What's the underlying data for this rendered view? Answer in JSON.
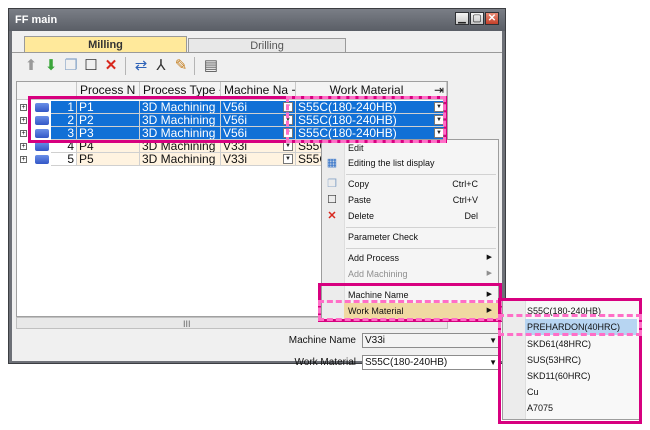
{
  "window": {
    "title": "FF main",
    "buttons": {
      "minimize": "▁",
      "maximize": "▢",
      "close": "✕"
    }
  },
  "tabs": [
    {
      "label": "Milling",
      "active": true
    },
    {
      "label": "Drilling",
      "active": false
    }
  ],
  "toolbar": {
    "icons": [
      "arrow-up-icon",
      "arrow-down-icon",
      "copy-icon",
      "paste-icon",
      "delete-icon",
      "link-icon",
      "axis-icon",
      "edit-list-icon",
      "database-icon"
    ]
  },
  "grid": {
    "columns": [
      "Process N",
      "Process Type",
      "Machine Na",
      "Work Material"
    ],
    "rows": [
      {
        "no": "1",
        "name": "P1",
        "type": "3D Machining",
        "machine": "V56i",
        "material": "S55C(180-240HB)",
        "selected": true
      },
      {
        "no": "2",
        "name": "P2",
        "type": "3D Machining",
        "machine": "V56i",
        "material": "S55C(180-240HB)",
        "selected": true
      },
      {
        "no": "3",
        "name": "P3",
        "type": "3D Machining",
        "machine": "V56i",
        "material": "S55C(180-240HB)",
        "selected": true
      },
      {
        "no": "4",
        "name": "P4",
        "type": "3D Machining",
        "machine": "V33i",
        "material": "S55C",
        "selected": false
      },
      {
        "no": "5",
        "name": "P5",
        "type": "3D Machining",
        "machine": "V33i",
        "material": "S55C",
        "selected": false
      }
    ],
    "scroll_glyph": "III"
  },
  "fields": {
    "machine_name": {
      "label": "Machine Name",
      "value": "V33i"
    },
    "work_material": {
      "label": "Work Material",
      "value": "S55C(180-240HB)"
    }
  },
  "context_menu": {
    "items": [
      {
        "label": "Edit",
        "shortcut": ""
      },
      {
        "label": "Editing the list display",
        "shortcut": ""
      },
      {
        "label": "Copy",
        "shortcut": "Ctrl+C"
      },
      {
        "label": "Paste",
        "shortcut": "Ctrl+V"
      },
      {
        "label": "Delete",
        "shortcut": "Del"
      },
      {
        "label": "Parameter Check",
        "shortcut": ""
      },
      {
        "label": "Add Process",
        "shortcut": ""
      },
      {
        "label": "Add Machining",
        "shortcut": ""
      },
      {
        "label": "Machine Name",
        "shortcut": ""
      },
      {
        "label": "Work Material",
        "shortcut": ""
      }
    ],
    "submenu_arrow": "▶"
  },
  "submenu": {
    "items": [
      "S55C(180-240HB)",
      "PREHARDON(40HRC)",
      "SKD61(48HRC)",
      "SUS(53HRC)",
      "SKD11(60HRC)",
      "Cu",
      "A7075"
    ],
    "hovered": "PREHARDON(40HRC)"
  },
  "colors": {
    "selection": "#1170d6",
    "highlight_solid": "#d7007f",
    "highlight_dashed": "#ff6ec7",
    "active_tab": "#ffe99b"
  }
}
